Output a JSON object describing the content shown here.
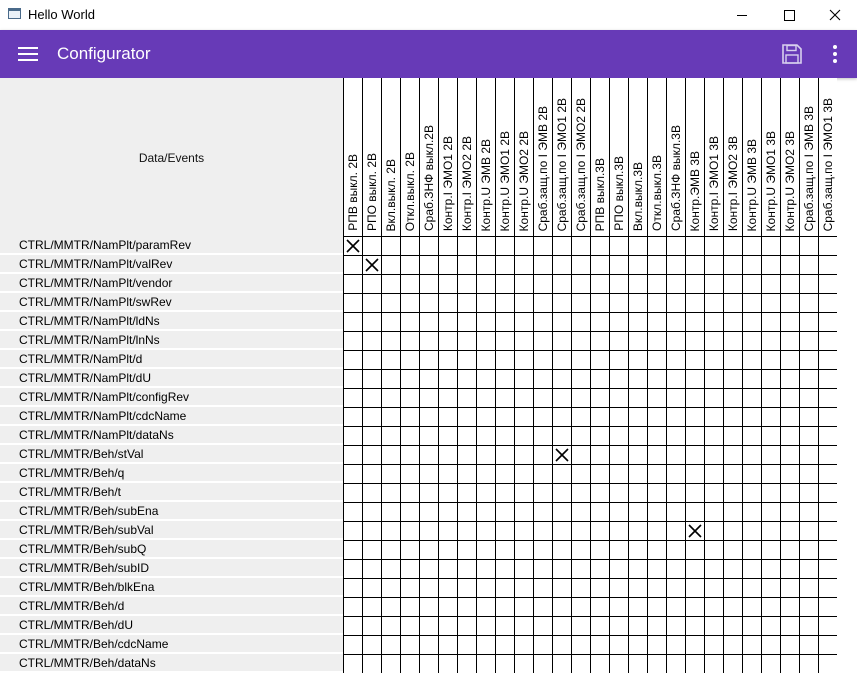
{
  "window": {
    "title": "Hello World"
  },
  "appbar": {
    "title": "Configurator"
  },
  "table": {
    "corner_label": "Data/Events",
    "columns": [
      "РПВ выкл. 2В",
      "РПО выкл. 2В",
      "Вкл.выкл. 2В",
      "Откл.выкл. 2В",
      "Сраб.ЗНФ выкл.2В",
      "Контр.I ЭМО1 2В",
      "Контр.I ЭМО2 2В",
      "Контр.U ЭМВ 2В",
      "Контр.U ЭМО1 2В",
      "Контр.U ЭМО2 2В",
      "Сраб.защ.по I ЭМВ 2В",
      "Сраб.защ.по I ЭМО1 2В",
      "Сраб.защ.по I ЭМО2 2В",
      "РПВ выкл.3В",
      "РПО выкл.3В",
      "Вкл.выкл.3В",
      "Откл.выкл.3В",
      "Сраб.ЗНФ выкл.3В",
      "Контр.ЭМВ 3В",
      "Контр.I ЭМО1 3В",
      "Контр.I ЭМО2 3В",
      "Контр.U ЭМВ 3В",
      "Контр.U ЭМО1 3В",
      "Контр.U ЭМО2 3В",
      "Сраб.защ.по I ЭМВ 3В",
      "Сраб.защ.по I ЭМО1 3В"
    ],
    "rows": [
      "CTRL/MMTR/NamPlt/paramRev",
      "CTRL/MMTR/NamPlt/valRev",
      "CTRL/MMTR/NamPlt/vendor",
      "CTRL/MMTR/NamPlt/swRev",
      "CTRL/MMTR/NamPlt/ldNs",
      "CTRL/MMTR/NamPlt/lnNs",
      "CTRL/MMTR/NamPlt/d",
      "CTRL/MMTR/NamPlt/dU",
      "CTRL/MMTR/NamPlt/configRev",
      "CTRL/MMTR/NamPlt/cdcName",
      "CTRL/MMTR/NamPlt/dataNs",
      "CTRL/MMTR/Beh/stVal",
      "CTRL/MMTR/Beh/q",
      "CTRL/MMTR/Beh/t",
      "CTRL/MMTR/Beh/subEna",
      "CTRL/MMTR/Beh/subVal",
      "CTRL/MMTR/Beh/subQ",
      "CTRL/MMTR/Beh/subID",
      "CTRL/MMTR/Beh/blkEna",
      "CTRL/MMTR/Beh/d",
      "CTRL/MMTR/Beh/dU",
      "CTRL/MMTR/Beh/cdcName",
      "CTRL/MMTR/Beh/dataNs"
    ],
    "checked": [
      [
        0,
        0
      ],
      [
        1,
        1
      ],
      [
        11,
        11
      ],
      [
        15,
        18
      ]
    ]
  },
  "icons": {
    "menu": "hamburger-icon",
    "save": "save-icon",
    "more": "more-vert-icon"
  },
  "colors": {
    "appbar": "#673ab7",
    "header_bg": "#efefef"
  }
}
